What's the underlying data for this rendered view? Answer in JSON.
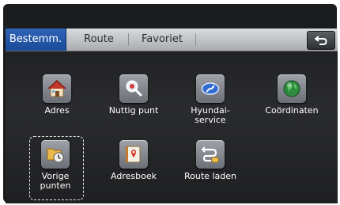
{
  "tabs": [
    {
      "label": "Bestemm.",
      "active": true
    },
    {
      "label": "Route",
      "active": false
    },
    {
      "label": "Favoriet",
      "active": false
    }
  ],
  "back_icon": "back-arrow-icon",
  "menu": {
    "adres": {
      "label": "Adres",
      "icon": "house-icon"
    },
    "nuttig_punt": {
      "label": "Nuttig punt",
      "icon": "magnifier-icon"
    },
    "hyundai": {
      "label_line1": "Hyundai-",
      "label_line2": "service",
      "icon": "hyundai-logo-icon"
    },
    "coordinaten": {
      "label": "Coördinaten",
      "icon": "globe-icon"
    },
    "vorige": {
      "label_line1": "Vorige",
      "label_line2": "punten",
      "icon": "history-folder-icon"
    },
    "adresboek": {
      "label": "Adresboek",
      "icon": "address-book-icon"
    },
    "route_laden": {
      "label": "Route laden",
      "icon": "route-load-icon"
    }
  },
  "colors": {
    "active_tab": "#1b4b9a",
    "screen_bg": "#1d1e20"
  }
}
